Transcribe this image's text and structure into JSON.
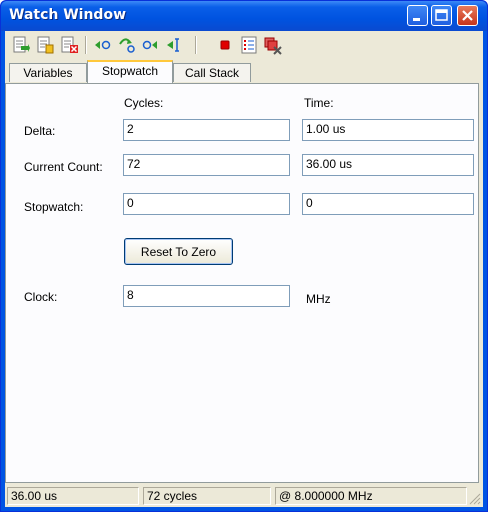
{
  "window": {
    "title": "Watch Window"
  },
  "toolbar": {
    "icons": [
      "add-watch-icon",
      "add-symbol-icon",
      "delete-watch-icon",
      "step-into-icon",
      "step-over-icon",
      "step-out-icon",
      "run-to-cursor-icon",
      "stop-icon",
      "list-icon",
      "clear-icon"
    ],
    "colors": {
      "green": "#2e9e2e",
      "red": "#e00000",
      "blue": "#1a5fd0"
    }
  },
  "tabs": [
    "Variables",
    "Stopwatch",
    "Call Stack"
  ],
  "active_tab": "Stopwatch",
  "stopwatch": {
    "header_cycles": "Cycles:",
    "header_time": "Time:",
    "delta_label": "Delta:",
    "delta_cycles": "2",
    "delta_time": "1.00 us",
    "current_label": "Current Count:",
    "current_cycles": "72",
    "current_time": "36.00 us",
    "stopwatch_label": "Stopwatch:",
    "stopwatch_cycles": "0",
    "stopwatch_time": "0",
    "reset_button": "Reset To Zero",
    "clock_label": "Clock:",
    "clock_value": "8",
    "clock_unit": "MHz"
  },
  "status": {
    "time": "36.00 us",
    "cycles": "72 cycles",
    "freq": "@ 8.000000 MHz"
  }
}
